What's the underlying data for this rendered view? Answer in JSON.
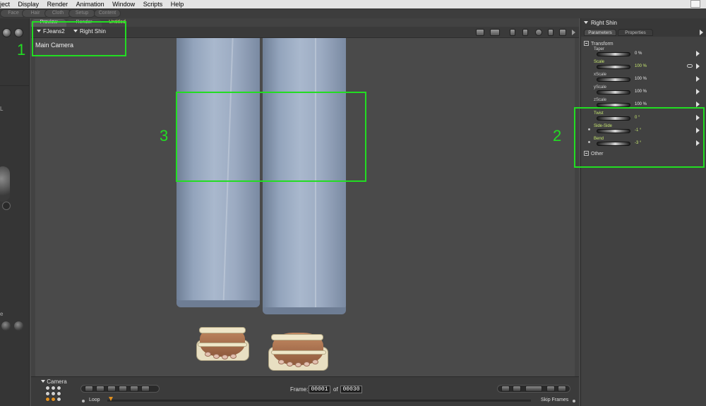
{
  "menu": [
    "ject",
    "Display",
    "Render",
    "Animation",
    "Window",
    "Scripts",
    "Help"
  ],
  "room_tabs": [
    "Face",
    "Hair",
    "Cloth",
    "Setup",
    "Content"
  ],
  "doc_tabs": {
    "preview": "Preview",
    "render": "Render",
    "untitled": "Untitled"
  },
  "doc_header": {
    "figure": "FJeans2",
    "actor": "Right Shin",
    "camera": "Main Camera"
  },
  "right_panel": {
    "title": "Right Shin",
    "tabs": [
      "Parameters",
      "Properties"
    ],
    "group_transform": "Transform",
    "group_other": "Other",
    "params": [
      {
        "name": "Taper",
        "value": "0 %"
      },
      {
        "name": "Scale",
        "value": "100 %"
      },
      {
        "name": "xScale",
        "value": "100 %"
      },
      {
        "name": "yScale",
        "value": "100 %"
      },
      {
        "name": "zScale",
        "value": "100 %"
      },
      {
        "name": "Twist",
        "value": "0 °"
      },
      {
        "name": "Side-Side",
        "value": "-1 °"
      },
      {
        "name": "Bend",
        "value": "-3 °"
      }
    ]
  },
  "timeline": {
    "pad_label": "Camera",
    "frame_label": "Frame:",
    "frame_current": "00001",
    "frame_of": "of",
    "frame_total": "00030",
    "loop_label": "Loop",
    "skip_label": "Skip Frames"
  },
  "annotations": [
    "1",
    "2",
    "3"
  ],
  "left_letters": [
    "L",
    "e"
  ],
  "colors": {
    "annotation": "#22dd22",
    "highlight_param": "#c8e870",
    "jeans": "#9cabc2"
  }
}
